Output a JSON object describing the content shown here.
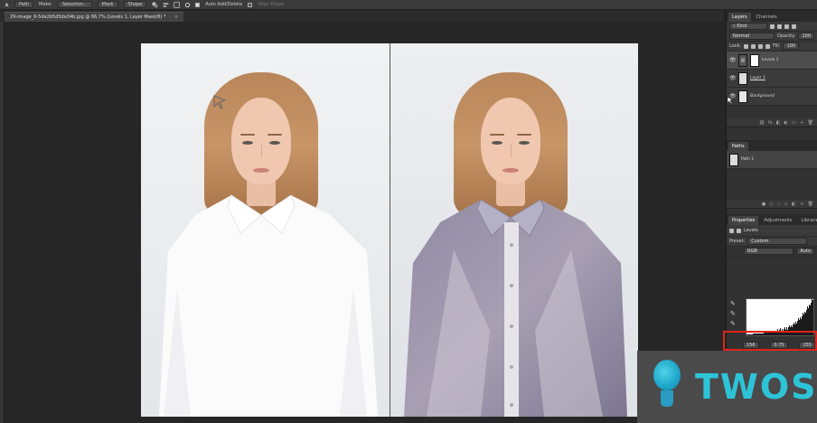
{
  "options_bar": {
    "path_mode": "Path",
    "make_label": "Make:",
    "selection_btn": "Selection...",
    "mask_btn": "Mask",
    "shape_btn": "Shape",
    "auto_add_delete": "Auto Add/Delete",
    "align_edges": "Align Edges"
  },
  "document": {
    "tab_title": "29-image_6-5de2b5d5da34b.jpg @ 66.7% (Levels 1, Layer Mask/8) *",
    "close": "×"
  },
  "layers_panel": {
    "tabs": [
      "Layers",
      "Channels"
    ],
    "filter_kind": "Kind",
    "blend_mode": "Normal",
    "opacity_label": "Opacity:",
    "opacity_value": "100",
    "lock_label": "Lock:",
    "fill_label": "Fill:",
    "fill_value": "100",
    "layers": [
      {
        "name": "Levels 1",
        "type": "adjustment"
      },
      {
        "name": "Layer 1",
        "type": "pixel"
      },
      {
        "name": "Background",
        "type": "background"
      }
    ]
  },
  "paths_panel": {
    "tab": "Paths",
    "paths": [
      {
        "name": "Path 1"
      }
    ]
  },
  "properties_panel": {
    "tabs": [
      "Properties",
      "Adjustments",
      "Libraries"
    ],
    "adjustment_name": "Levels",
    "preset_label": "Preset:",
    "preset_value": "Custom",
    "channel": "RGB",
    "auto_btn": "Auto",
    "input_black": "156",
    "input_gamma": "0.75",
    "input_white": "255"
  },
  "watermark": {
    "text": "TWOS"
  },
  "colors": {
    "highlight_box": "#e0241b",
    "watermark_text": "#2ec4d8"
  }
}
